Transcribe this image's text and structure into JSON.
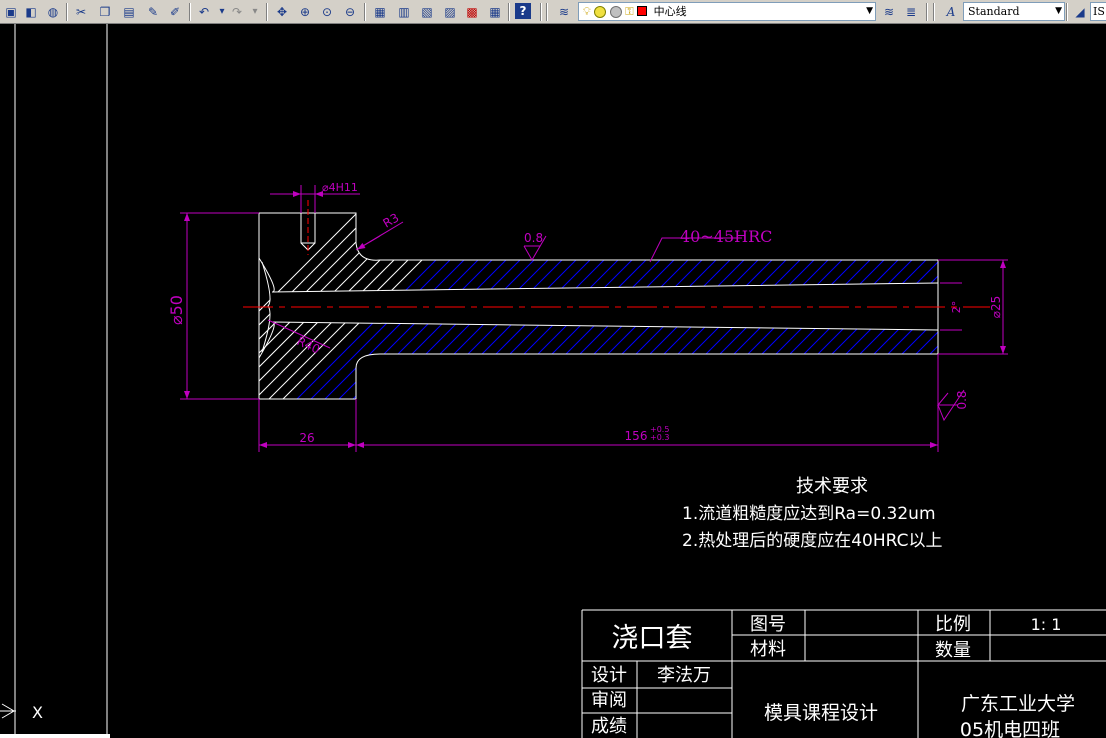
{
  "toolbar": {
    "layer_name": "中心线",
    "text_style": "Standard",
    "dim_style": "IS",
    "icons": [
      "new-icon",
      "open-icon",
      "globe-icon",
      "cut-icon",
      "copy-icon",
      "paste-icon",
      "match-properties-icon",
      "brush-icon",
      "undo-icon",
      "redo-icon",
      "pan-icon",
      "zoom-realtime-icon",
      "zoom-window-icon",
      "zoom-previous-icon",
      "properties-icon",
      "design-center-icon",
      "tool-palette-icon",
      "sheet-set-icon",
      "markup-icon",
      "calculator-icon",
      "help-icon",
      "layers-icon",
      "layer-previous-icon",
      "text-style-icon",
      "dim-style-icon"
    ],
    "colors": {
      "toolbar_bg": "#d4d0c8",
      "layer_color": "#ff0000"
    }
  },
  "drawing": {
    "dims": {
      "hole": "⌀4H11",
      "radius_small": "R3",
      "radius_large": "R40",
      "diameter_head": "⌀50",
      "diameter_body": "⌀25",
      "taper": "2°",
      "roughness_top": "0.8",
      "roughness_end": "0.8",
      "hardness": "40~45HRC",
      "len_head": "26",
      "len_body": "156",
      "tol_upper": "+0.5",
      "tol_lower": "+0.3"
    },
    "notes": {
      "title": "技术要求",
      "line1": "1.流道粗糙度应达到Ra=0.32um",
      "line2": "2.热处理后的硬度应在40HRC以上"
    },
    "titleblock": {
      "part_name": "浇口套",
      "drawing_no_label": "图号",
      "material_label": "材料",
      "scale_label": "比例",
      "scale_value": "1: 1",
      "qty_label": "数量",
      "design_label": "设计",
      "designer": "李法万",
      "review_label": "审阅",
      "grade_label": "成绩",
      "project": "模具课程设计",
      "school": "广东工业大学",
      "class": "05机电四班"
    },
    "ucs": {
      "x_label": "X"
    },
    "colors": {
      "hatch": "#0000ff",
      "center": "#ff0000",
      "dim": "#c000c0",
      "outline": "#ffffff"
    }
  }
}
